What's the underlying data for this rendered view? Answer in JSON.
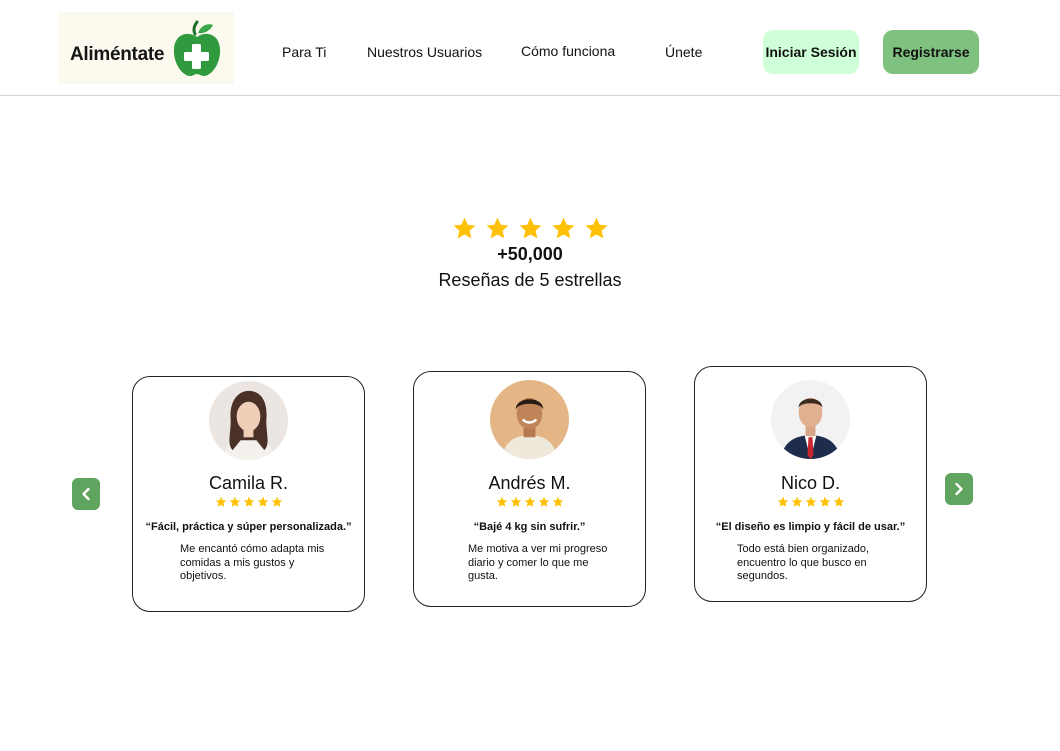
{
  "brand": {
    "name": "Aliméntate"
  },
  "nav": {
    "items": [
      {
        "label": "Para Ti"
      },
      {
        "label": "Nuestros Usuarios"
      },
      {
        "label": "Cómo funciona"
      },
      {
        "label": "Únete"
      }
    ],
    "login_label": "Iniciar Sesión",
    "register_label": "Registrarse"
  },
  "rating": {
    "stars": 5,
    "count": "+50,000",
    "subtitle": "Reseñas de 5 estrellas"
  },
  "testimonials": [
    {
      "name": "Camila R.",
      "stars": 5,
      "quote": "“Fácil, práctica y súper personalizada.”",
      "text": "Me encantó cómo adapta mis comidas a mis gustos y objetivos."
    },
    {
      "name": "Andrés M.",
      "stars": 5,
      "quote": "“Bajé 4 kg sin sufrir.”",
      "text": "Me motiva a ver mi progreso diario y comer lo que me gusta."
    },
    {
      "name": "Nico D.",
      "stars": 5,
      "quote": "“El diseño es limpio y fácil de usar.”",
      "text": "Todo está bien organizado, encuentro lo que busco en segundos."
    }
  ],
  "colors": {
    "star": "#ffc107",
    "login_bg": "#cfffd6",
    "register_bg": "#7fc17e",
    "arrow_bg": "#5fa55f",
    "apple_green": "#2f9a3e"
  },
  "icons": {
    "logo": "apple-plus-icon",
    "prev": "chevron-left-icon",
    "next": "chevron-right-icon",
    "star": "star-icon"
  }
}
